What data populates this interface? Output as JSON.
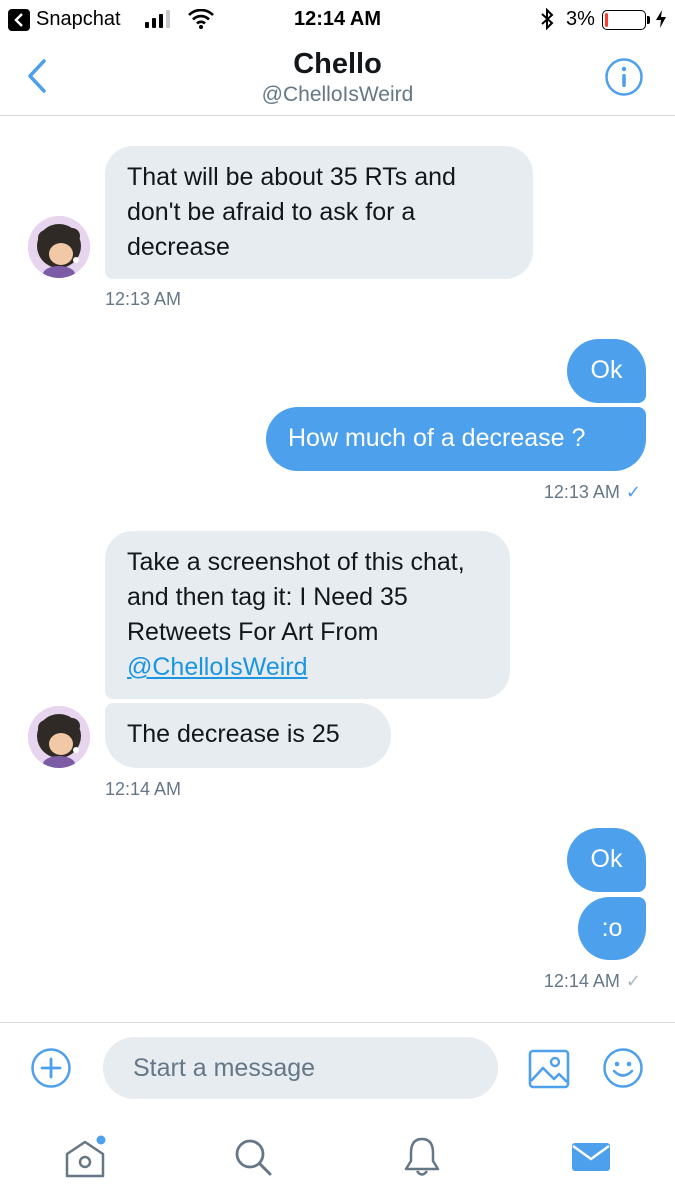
{
  "status_bar": {
    "app_name": "Snapchat",
    "time": "12:14 AM",
    "battery_percent": "3%",
    "battery_level": 0.03
  },
  "header": {
    "title": "Chello",
    "handle": "@ChelloIsWeird"
  },
  "messages": [
    {
      "from": "them",
      "text": "That will be about 35 RTs and don't be afraid to ask for a decrease"
    },
    {
      "timestamp": "12:13 AM"
    },
    {
      "from": "me",
      "text": "Ok"
    },
    {
      "from": "me",
      "text": "How much of a decrease ?"
    },
    {
      "timestamp": "12:13 AM",
      "read": true
    },
    {
      "from": "them",
      "text": "Take a screenshot of this chat, and then tag it: I Need 35 Retweets For Art From ",
      "link": "@ChelloIsWeird"
    },
    {
      "from": "them",
      "text": "The decrease is 25"
    },
    {
      "timestamp": "12:14 AM"
    },
    {
      "from": "me",
      "text": "Ok"
    },
    {
      "from": "me",
      "text": ":o"
    },
    {
      "timestamp": "12:14 AM",
      "read": false
    }
  ],
  "check_mark": "✓",
  "composer": {
    "placeholder": "Start a message"
  },
  "icons": {
    "back": "chevron-left-icon",
    "info": "info-icon",
    "add": "plus-circle-icon",
    "gif": "image-icon",
    "emoji": "smiley-icon",
    "home": "home-icon",
    "search": "search-icon",
    "notifications": "bell-icon",
    "messages": "mail-icon"
  },
  "colors": {
    "accent": "#4da0ec",
    "incoming_bubble": "#e6ecf0",
    "timestamp": "#657786",
    "battery_low": "#ff3b30"
  }
}
